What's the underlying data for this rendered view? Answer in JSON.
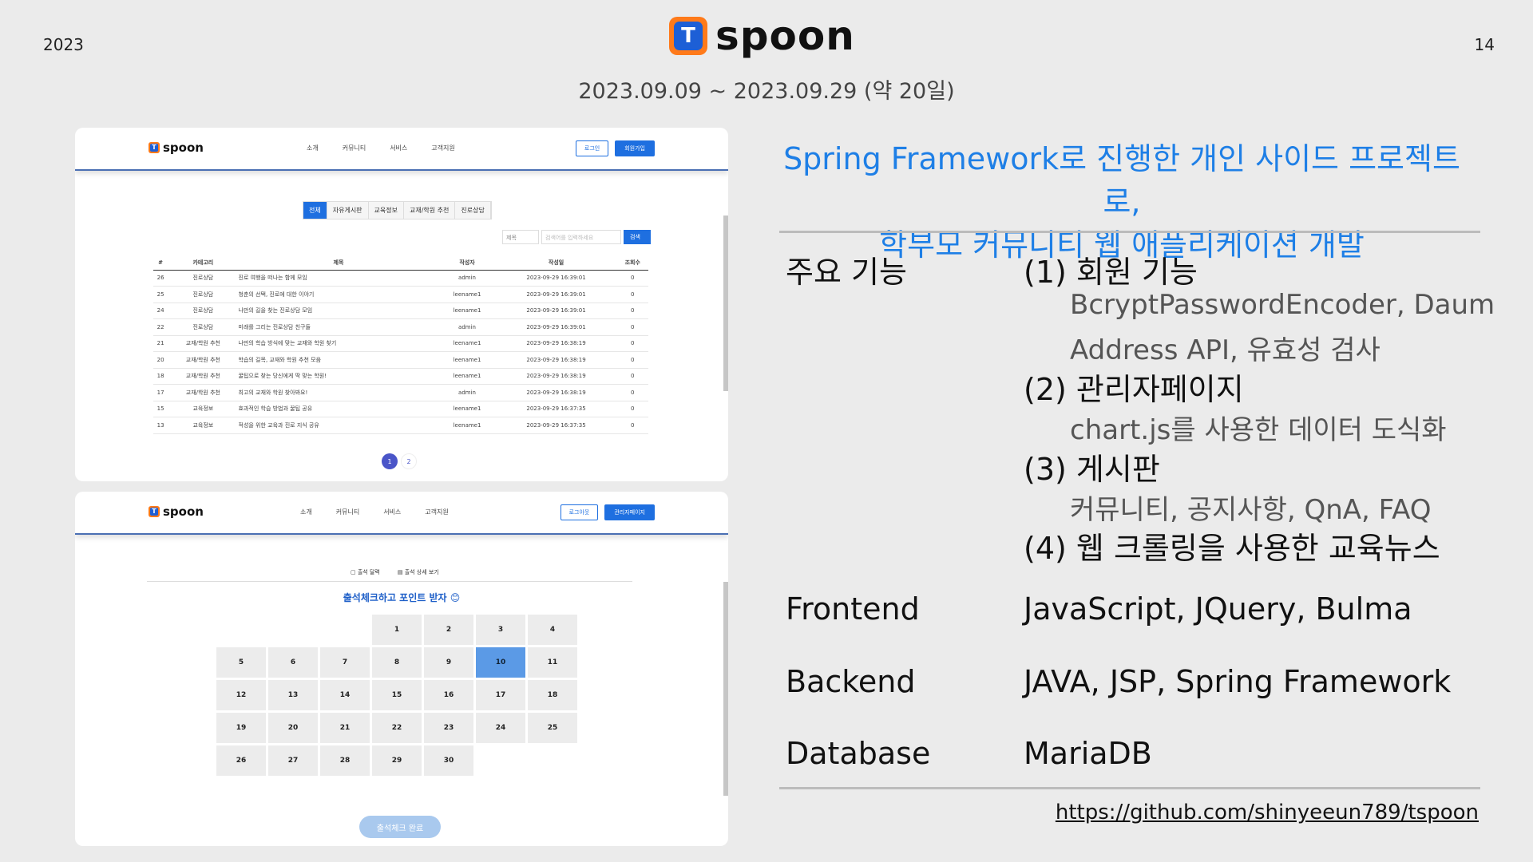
{
  "header": {
    "year": "2023",
    "page_number": "14",
    "logo_text": "spoon",
    "logo_mark": "T",
    "period": "2023.09.09 ~ 2023.09.29 (약 20일)"
  },
  "screenshot1": {
    "logo_text": "spoon",
    "menu": [
      "소개",
      "커뮤니티",
      "서비스",
      "고객지원"
    ],
    "login_button": "로그인",
    "signup_button": "회원가입",
    "tabs": [
      "전체",
      "자유게시판",
      "교육정보",
      "교재/학원 추천",
      "진로상담"
    ],
    "search_select": "제목",
    "search_placeholder": "검색어를 입력하세요",
    "search_button": "검색",
    "columns": [
      "#",
      "카테고리",
      "제목",
      "작성자",
      "작성일",
      "조회수"
    ],
    "rows": [
      [
        "26",
        "진로상담",
        "진로 여행을 떠나는 함께 모임",
        "admin",
        "2023-09-29 16:39:01",
        "0"
      ],
      [
        "25",
        "진로상담",
        "청춘의 선택, 진로에 대한 이야기",
        "leename1",
        "2023-09-29 16:39:01",
        "0"
      ],
      [
        "24",
        "진로상담",
        "나만의 길을 찾는 진로상담 모임",
        "leename1",
        "2023-09-29 16:39:01",
        "0"
      ],
      [
        "22",
        "진로상담",
        "미래를 그리는 진로상담 친구들",
        "admin",
        "2023-09-29 16:39:01",
        "0"
      ],
      [
        "21",
        "교재/학원 추천",
        "나만의 학습 방식에 맞는 교재와 학원 찾기",
        "leename1",
        "2023-09-29 16:38:19",
        "0"
      ],
      [
        "20",
        "교재/학원 추천",
        "학습의 길목, 교재와 학원 추천 모음",
        "leename1",
        "2023-09-29 16:38:19",
        "0"
      ],
      [
        "18",
        "교재/학원 추천",
        "꿀팁으로 찾는 당신에게 딱 맞는 학원!",
        "leename1",
        "2023-09-29 16:38:19",
        "0"
      ],
      [
        "17",
        "교재/학원 추천",
        "최고의 교재와 학원 찾아봐요!",
        "admin",
        "2023-09-29 16:38:19",
        "0"
      ],
      [
        "15",
        "교육정보",
        "효과적인 학습 방법과 꿀팁 공유",
        "leename1",
        "2023-09-29 16:37:35",
        "0"
      ],
      [
        "13",
        "교육정보",
        "적성을 위한 교육과 진로 지식 공유",
        "leename1",
        "2023-09-29 16:37:35",
        "0"
      ]
    ],
    "pages": [
      "1",
      "2"
    ]
  },
  "screenshot2": {
    "logo_text": "spoon",
    "menu": [
      "소개",
      "커뮤니티",
      "서비스",
      "고객지원"
    ],
    "logout_button": "로그아웃",
    "admin_button": "관리자페이지",
    "att_tabs": [
      "출석 달력",
      "출석 상세 보기"
    ],
    "title": "출석체크하고 포인트 받자 😊",
    "calendar": [
      "",
      "",
      "",
      "1",
      "2",
      "3",
      "4",
      "5",
      "6",
      "7",
      "8",
      "9",
      "10",
      "11",
      "12",
      "13",
      "14",
      "15",
      "16",
      "17",
      "18",
      "19",
      "20",
      "21",
      "22",
      "23",
      "24",
      "25",
      "26",
      "27",
      "28",
      "29",
      "30"
    ],
    "today": "10",
    "done_button": "출석체크 완료"
  },
  "content": {
    "headline_line1": "Spring Framework로 진행한 개인 사이드 프로젝트로,",
    "headline_line2": "학부모 커뮤니티 웹 애플리케이션 개발",
    "features_label": "주요 기능",
    "feature1": "(1) 회원 기능",
    "feature1_detail1": "BcryptPasswordEncoder, Daum",
    "feature1_detail2": "Address API, 유효성 검사",
    "feature2": "(2) 관리자페이지",
    "feature2_detail": "chart.js를 사용한 데이터 도식화",
    "feature3": "(3) 게시판",
    "feature3_detail": "커뮤니티, 공지사항, QnA, FAQ",
    "feature4": "(4) 웹 크롤링을 사용한 교육뉴스",
    "frontend_label": "Frontend",
    "frontend_value": "JavaScript, JQuery, Bulma",
    "backend_label": "Backend",
    "backend_value": "JAVA, JSP, Spring Framework",
    "database_label": "Database",
    "database_value": "MariaDB",
    "repo_link": "https://github.com/shinyeeun789/tspoon"
  },
  "colors": {
    "accent": "#1e7fe6",
    "logo_orange": "#ff7a1a",
    "logo_blue": "#1d5fd6",
    "background": "#ebebeb"
  }
}
